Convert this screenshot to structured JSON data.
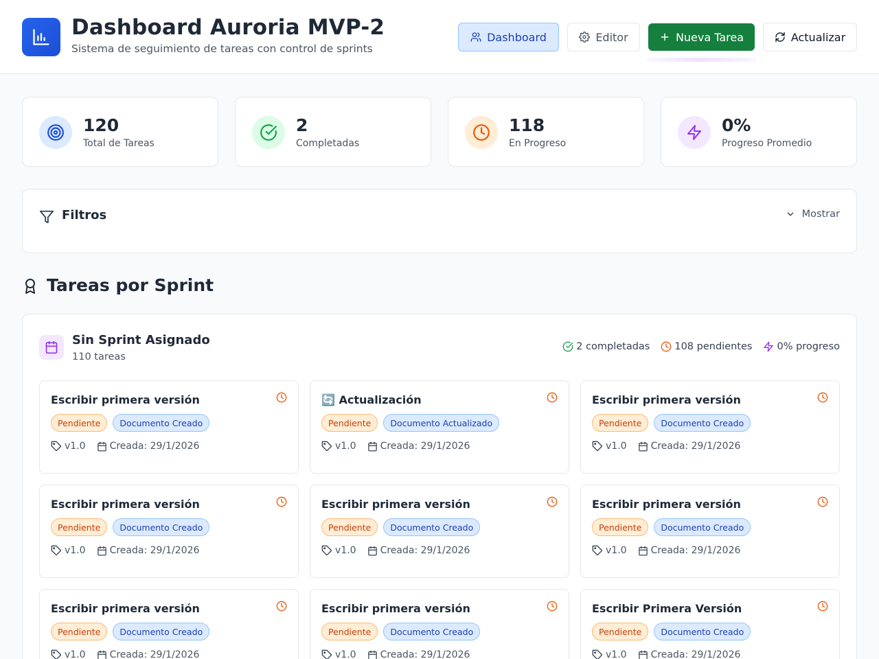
{
  "header": {
    "title": "Dashboard Auroria MVP-2",
    "subtitle": "Sistema de seguimiento de tareas con control de sprints",
    "buttons": {
      "dashboard": "Dashboard",
      "editor": "Editor",
      "new_task": "Nueva Tarea",
      "refresh": "Actualizar"
    }
  },
  "stats": [
    {
      "value": "120",
      "label": "Total de Tareas",
      "icon": "target-icon",
      "color": "#1d4ed8",
      "bg": "#dbeafe"
    },
    {
      "value": "2",
      "label": "Completadas",
      "icon": "check-circle-icon",
      "color": "#16a34a",
      "bg": "#dcfce7"
    },
    {
      "value": "118",
      "label": "En Progreso",
      "icon": "clock-icon",
      "color": "#ea580c",
      "bg": "#ffedd5"
    },
    {
      "value": "0%",
      "label": "Progreso Promedio",
      "icon": "zap-icon",
      "color": "#9333ea",
      "bg": "#f3e8ff"
    }
  ],
  "filters": {
    "title": "Filtros",
    "toggle_label": "Mostrar"
  },
  "section": {
    "title": "Tareas por Sprint"
  },
  "sprint": {
    "title": "Sin Sprint Asignado",
    "count": "110 tareas",
    "completed": "2 completadas",
    "pending": "108 pendientes",
    "progress": "0% progreso"
  },
  "tasks": [
    {
      "title": "Escribir primera versión",
      "status": "Pendiente",
      "type": "Documento Creado",
      "version": "v1.0",
      "created": "Creada: 29/1/2026"
    },
    {
      "title": "🔄 Actualización",
      "status": "Pendiente",
      "type": "Documento Actualizado",
      "version": "v1.0",
      "created": "Creada: 29/1/2026"
    },
    {
      "title": "Escribir primera versión",
      "status": "Pendiente",
      "type": "Documento Creado",
      "version": "v1.0",
      "created": "Creada: 29/1/2026"
    },
    {
      "title": "Escribir primera versión",
      "status": "Pendiente",
      "type": "Documento Creado",
      "version": "v1.0",
      "created": "Creada: 29/1/2026"
    },
    {
      "title": "Escribir primera versión",
      "status": "Pendiente",
      "type": "Documento Creado",
      "version": "v1.0",
      "created": "Creada: 29/1/2026"
    },
    {
      "title": "Escribir primera versión",
      "status": "Pendiente",
      "type": "Documento Creado",
      "version": "v1.0",
      "created": "Creada: 29/1/2026"
    },
    {
      "title": "Escribir primera versión",
      "status": "Pendiente",
      "type": "Documento Creado",
      "version": "v1.0",
      "created": "Creada: 29/1/2026"
    },
    {
      "title": "Escribir primera versión",
      "status": "Pendiente",
      "type": "Documento Creado",
      "version": "v1.0",
      "created": "Creada: 29/1/2026"
    },
    {
      "title": "Escribir Primera Versión",
      "status": "Pendiente",
      "type": "Documento Creado",
      "version": "v1.0",
      "created": "Creada: 29/1/2026"
    }
  ]
}
